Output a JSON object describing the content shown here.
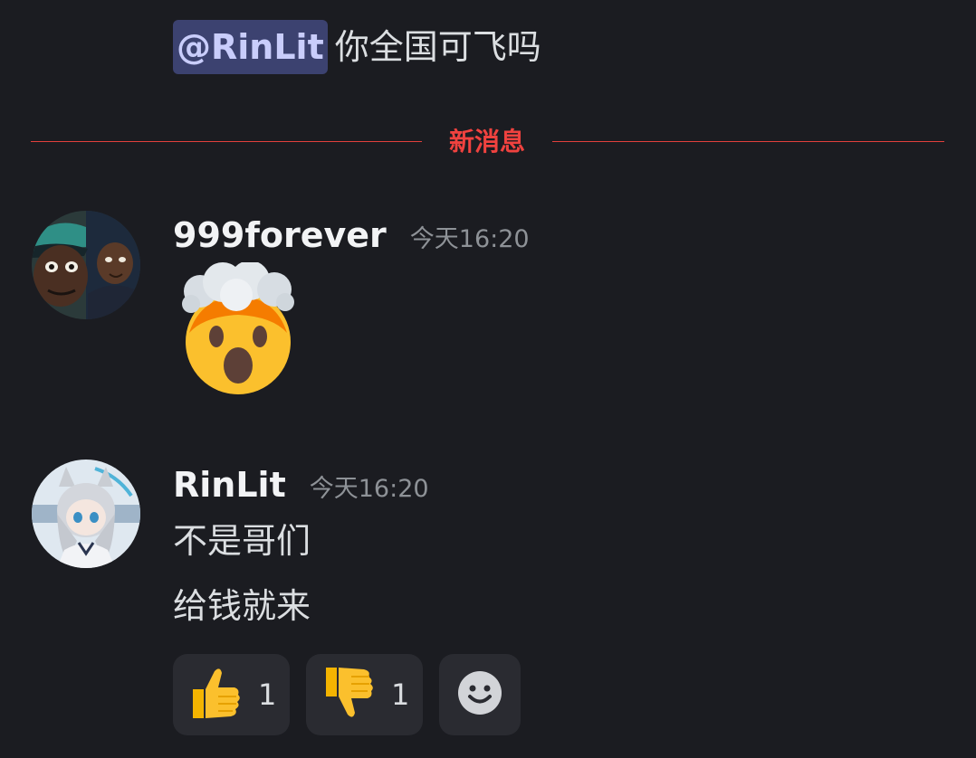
{
  "top_message": {
    "mention": "@RinLit",
    "text": "你全国可飞吗"
  },
  "divider": {
    "label": "新消息",
    "color": "#f0423f"
  },
  "messages": [
    {
      "username": "999forever",
      "timestamp": "今天16:20",
      "content_emoji": "exploding-head-emoji"
    },
    {
      "username": "RinLit",
      "timestamp": "今天16:20",
      "lines": [
        "不是哥们",
        "给钱就来"
      ]
    }
  ],
  "reactions": [
    {
      "icon": "thumbs-up-emoji",
      "count": "1"
    },
    {
      "icon": "thumbs-down-emoji",
      "count": "1"
    }
  ],
  "add_reaction_icon": "smiley-add-reaction-icon"
}
